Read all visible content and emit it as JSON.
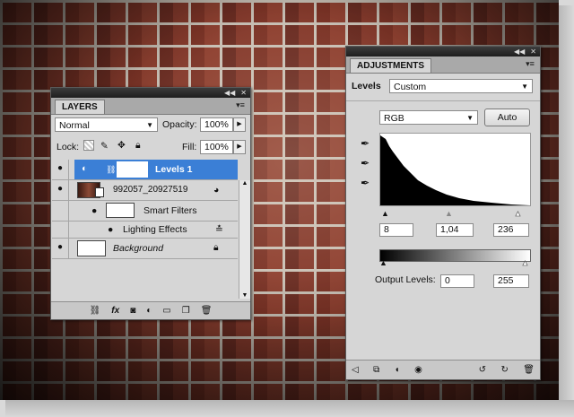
{
  "layers_panel": {
    "tab_label": "LAYERS",
    "blend_mode": "Normal",
    "opacity_label": "Opacity:",
    "opacity_value": "100%",
    "lock_label": "Lock:",
    "fill_label": "Fill:",
    "fill_value": "100%",
    "layers": [
      {
        "name": "Levels 1",
        "selected": true
      },
      {
        "name": "992057_20927519"
      },
      {
        "name": "Smart Filters"
      },
      {
        "name": "Lighting Effects"
      },
      {
        "name": "Background"
      }
    ],
    "selected_color": "#3b7fd6"
  },
  "adjustments_panel": {
    "tab_label": "ADJUSTMENTS",
    "title": "Levels",
    "preset": "Custom",
    "channel": "RGB",
    "auto_label": "Auto",
    "input_black": "8",
    "input_gamma": "1,04",
    "input_white": "236",
    "output_label": "Output Levels:",
    "output_black": "0",
    "output_white": "255"
  },
  "icons": [
    "eye-icon",
    "chain-icon",
    "brush-icon",
    "move-icon",
    "lock-icon",
    "eyedropper-icon",
    "fx-icon",
    "trash-icon",
    "menu-icon"
  ]
}
